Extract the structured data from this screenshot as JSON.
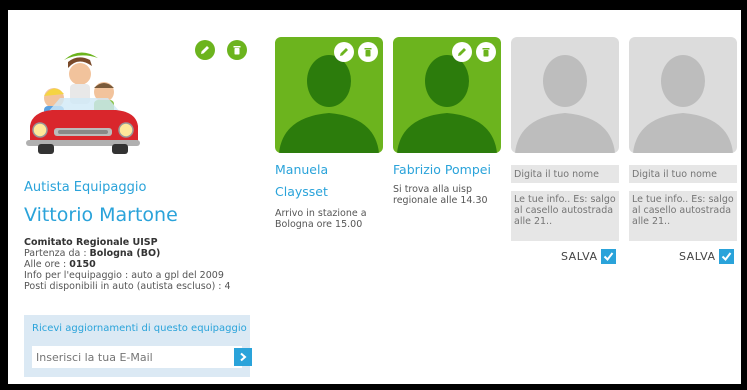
{
  "driver": {
    "role": "Autista Equipaggio",
    "name": "Vittorio Martone",
    "committee": "Comitato Regionale UISP",
    "departure_label": "Partenza da : ",
    "departure_value": "Bologna (BO)",
    "time_label": "Alle ore : ",
    "time_value": "0150",
    "crew_info": "Info per l'equipaggio : auto a gpl del 2009",
    "seats_info": "Posti disponibili in auto (autista escluso) : 4",
    "icons": [
      "pencil-icon",
      "trash-icon"
    ]
  },
  "subscribe": {
    "title": "Ricevi aggiornamenti di questo equipaggio",
    "placeholder": "Inserisci la tua E-Mail"
  },
  "passengers": [
    {
      "name_line1": "Manuela",
      "name_line2": "Claysset",
      "note": "Arrivo in stazione a\nBologna ore 15.00"
    },
    {
      "name_line1": "Fabrizio Pompei",
      "name_line2": "",
      "note": "Si trova alla uisp\nregionale alle 14.30"
    }
  ],
  "empty_slots": [
    {
      "name_placeholder": "Digita il tuo nome",
      "info_placeholder": "Le tue info.. Es: salgo\nal casello autostrada\nalle 21..",
      "save_label": "SALVA"
    },
    {
      "name_placeholder": "Digita il tuo nome",
      "info_placeholder": "Le tue info.. Es: salgo\nal casello autostrada\nalle 21..",
      "save_label": "SALVA"
    }
  ],
  "colors": {
    "accent_green": "#6cb41e",
    "accent_blue": "#2aa3da",
    "empty_gray": "#dcdcdc"
  }
}
